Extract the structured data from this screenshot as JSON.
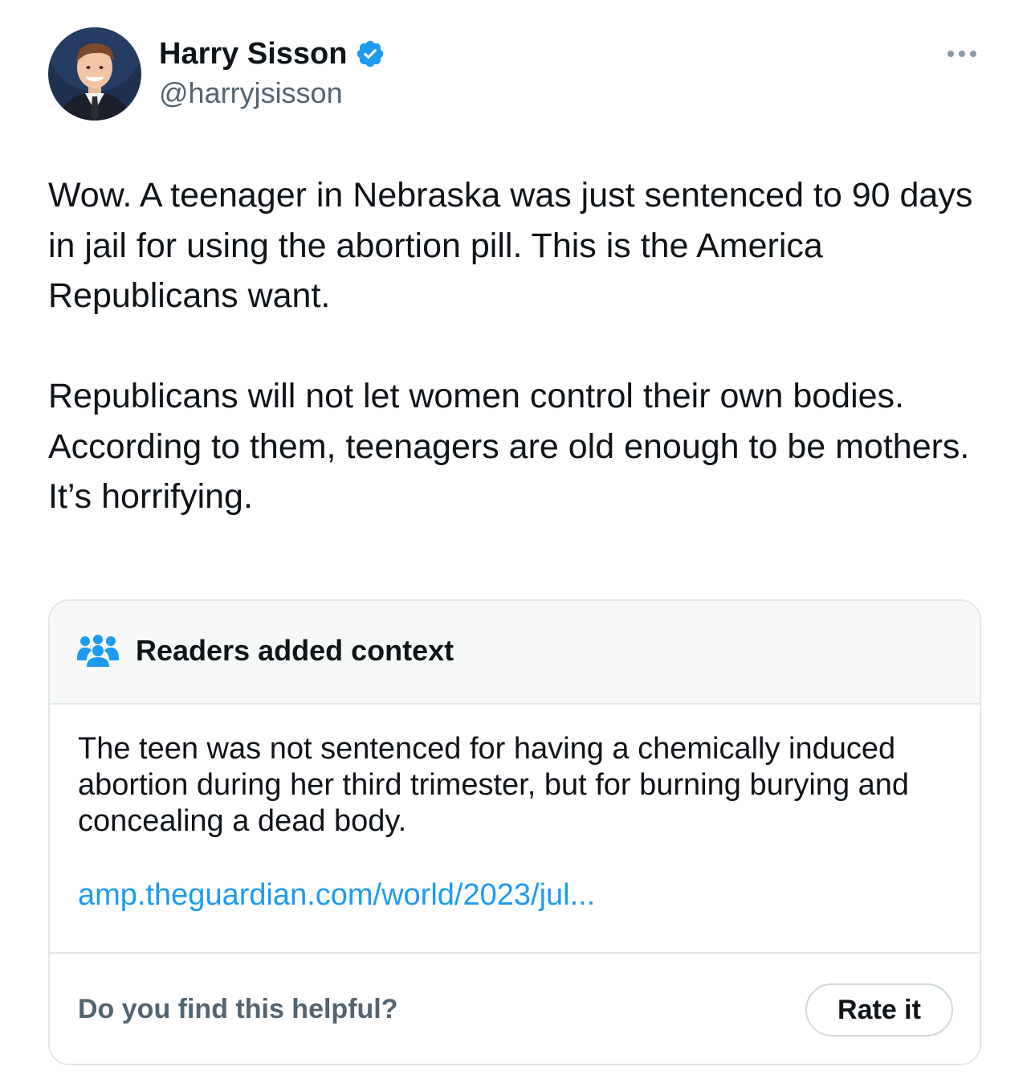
{
  "author": {
    "display_name": "Harry Sisson",
    "handle": "@harryjsisson",
    "verified": true,
    "verified_color": "#1d9bf0"
  },
  "tweet": {
    "paragraphs": [
      "Wow. A teenager in Nebraska was just sentenced to 90 days in jail for using the abortion pill. This is the America Republicans want.",
      "Republicans will not let women control their own bodies. According to them, teenagers are old enough to be mothers. It’s horrifying."
    ]
  },
  "community_note": {
    "header_icon": "people-icon",
    "title": "Readers added context",
    "body": "The teen was not sentenced for having a chemically induced abortion during her third trimester, but for burning burying and concealing a dead body.",
    "link_text": "amp.theguardian.com/world/2023/jul...",
    "helpful_question": "Do you find this helpful?",
    "rate_button_label": "Rate it",
    "link_color": "#1d9bf0",
    "icon_color": "#1d9bf0"
  },
  "icons": {
    "more": "more-horizontal-icon",
    "verified": "verified-badge-icon"
  }
}
